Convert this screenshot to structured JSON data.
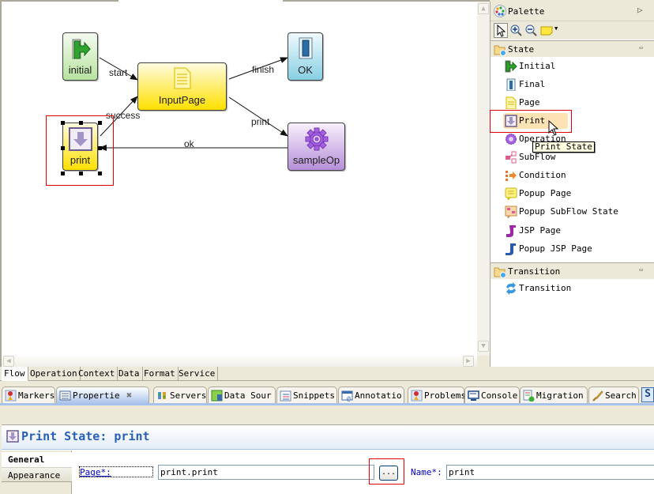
{
  "diagram": {
    "nodes": {
      "initial": {
        "label": "initial",
        "type": "Initial"
      },
      "inputpage": {
        "label": "InputPage",
        "type": "Page"
      },
      "ok": {
        "label": "OK",
        "type": "Final"
      },
      "sampleop": {
        "label": "sampleOp",
        "type": "Operation"
      },
      "print": {
        "label": "print",
        "type": "Print",
        "selected": true
      }
    },
    "edges": [
      {
        "from": "initial",
        "to": "inputpage",
        "label": "start"
      },
      {
        "from": "inputpage",
        "to": "ok",
        "label": "finish"
      },
      {
        "from": "inputpage",
        "to": "sampleop",
        "label": "print"
      },
      {
        "from": "sampleop",
        "to": "print",
        "label": "ok"
      },
      {
        "from": "print",
        "to": "inputpage",
        "label": "success"
      }
    ]
  },
  "palette": {
    "title": "Palette",
    "tools": [
      "select-tool",
      "zoom-in-tool",
      "zoom-out-tool",
      "note-tool"
    ],
    "drawers": [
      {
        "title": "State",
        "items": [
          {
            "label": "Initial",
            "icon": "initial-icon"
          },
          {
            "label": "Final",
            "icon": "final-icon"
          },
          {
            "label": "Page",
            "icon": "page-icon"
          },
          {
            "label": "Print",
            "icon": "print-icon",
            "hover": true
          },
          {
            "label": "Operation",
            "icon": "operation-icon"
          },
          {
            "label": "SubFlow",
            "icon": "subflow-icon"
          },
          {
            "label": "Condition",
            "icon": "condition-icon"
          },
          {
            "label": "Popup Page",
            "icon": "popup-page-icon"
          },
          {
            "label": "Popup SubFlow State",
            "icon": "popup-subflow-icon"
          },
          {
            "label": "JSP Page",
            "icon": "jsp-page-icon"
          },
          {
            "label": "Popup JSP Page",
            "icon": "popup-jsp-icon"
          }
        ]
      },
      {
        "title": "Transition",
        "items": [
          {
            "label": "Transition",
            "icon": "transition-icon"
          }
        ]
      }
    ],
    "tooltip": "Print State"
  },
  "editor_tabs": [
    {
      "label": "Flow",
      "active": true
    },
    {
      "label": "Operation"
    },
    {
      "label": "Context"
    },
    {
      "label": "Data"
    },
    {
      "label": "Format"
    },
    {
      "label": "Service"
    }
  ],
  "view_tabs": [
    {
      "label": "Markers"
    },
    {
      "label": "Propertie",
      "active": true
    },
    {
      "label": "Servers"
    },
    {
      "label": "Data Sour"
    },
    {
      "label": "Snippets"
    },
    {
      "label": "Annotatio"
    },
    {
      "label": "Problems"
    },
    {
      "label": "Console"
    },
    {
      "label": "Migration"
    },
    {
      "label": "Search"
    }
  ],
  "properties": {
    "title": "Print State: print",
    "tabs": [
      {
        "label": "General",
        "active": true
      },
      {
        "label": "Appearance"
      }
    ],
    "page_label": "Page*:",
    "page_value": "print.print",
    "browse_label": "...",
    "name_label": "Name*:",
    "name_value": "print"
  }
}
